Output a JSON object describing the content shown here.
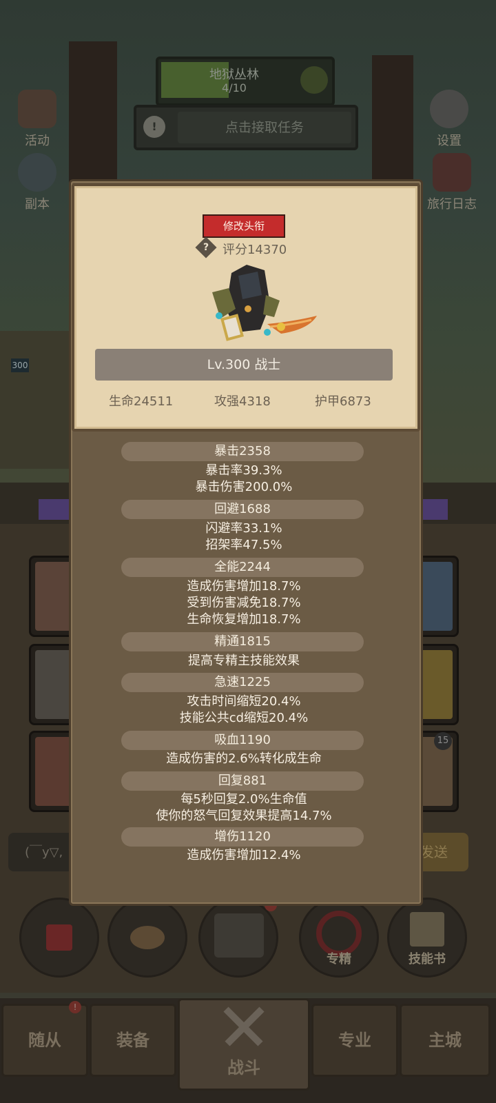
{
  "top_hud": {
    "quest_title": "地狱丛林",
    "quest_progress_text": "4/10",
    "quest_progress_fraction": 0.4,
    "task_button": "点击接取任务",
    "alert_symbol": "!",
    "left_buttons": [
      {
        "label": "活动",
        "icon": "event-book-icon"
      },
      {
        "label": "副本",
        "icon": "dungeon-portal-icon"
      }
    ],
    "right_buttons": [
      {
        "label": "设置",
        "icon": "gear-icon"
      },
      {
        "label": "旅行日志",
        "icon": "journal-icon"
      }
    ],
    "hero_level_badge": "300"
  },
  "chat": {
    "input_text": "(￣y▽,",
    "send_label": "发送"
  },
  "action_buttons": [
    {
      "label": "",
      "icon": "potion-icon"
    },
    {
      "label": "",
      "icon": "bread-icon"
    },
    {
      "label": "",
      "icon": "treasure-chest-icon"
    },
    {
      "label": "专精",
      "icon": "specialization-icon"
    },
    {
      "label": "技能书",
      "icon": "skill-book-icon"
    }
  ],
  "skill_slot_badge": "15",
  "bottom_nav": {
    "tabs": [
      "随从",
      "装备",
      "战斗",
      "专业",
      "主城"
    ],
    "alert_symbol": "!"
  },
  "colors": {
    "rename_button": "#c42c2c",
    "card_bg": "#e6d4b0",
    "modal_bg": "#6b5b45"
  },
  "character": {
    "rename_button": "修改头衔",
    "help_symbol": "?",
    "score": "评分14370",
    "level_class": "Lv.300 战士",
    "hp": "生命24511",
    "attack": "攻强4318",
    "armor": "护甲6873"
  },
  "stats": [
    {
      "header": "暴击2358",
      "lines": [
        "暴击率39.3%",
        "暴击伤害200.0%"
      ]
    },
    {
      "header": "回避1688",
      "lines": [
        "闪避率33.1%",
        "招架率47.5%"
      ]
    },
    {
      "header": "全能2244",
      "lines": [
        "造成伤害增加18.7%",
        "受到伤害减免18.7%",
        "生命恢复增加18.7%"
      ]
    },
    {
      "header": "精通1815",
      "lines": [
        "提高专精主技能效果"
      ]
    },
    {
      "header": "急速1225",
      "lines": [
        "攻击时间缩短20.4%",
        "技能公共cd缩短20.4%"
      ]
    },
    {
      "header": "吸血1190",
      "lines": [
        "造成伤害的2.6%转化成生命"
      ]
    },
    {
      "header": "回复881",
      "lines": [
        "每5秒回复2.0%生命值",
        "使你的怒气回复效果提高14.7%"
      ]
    },
    {
      "header": "增伤1120",
      "lines": [
        "造成伤害增加12.4%"
      ]
    }
  ]
}
